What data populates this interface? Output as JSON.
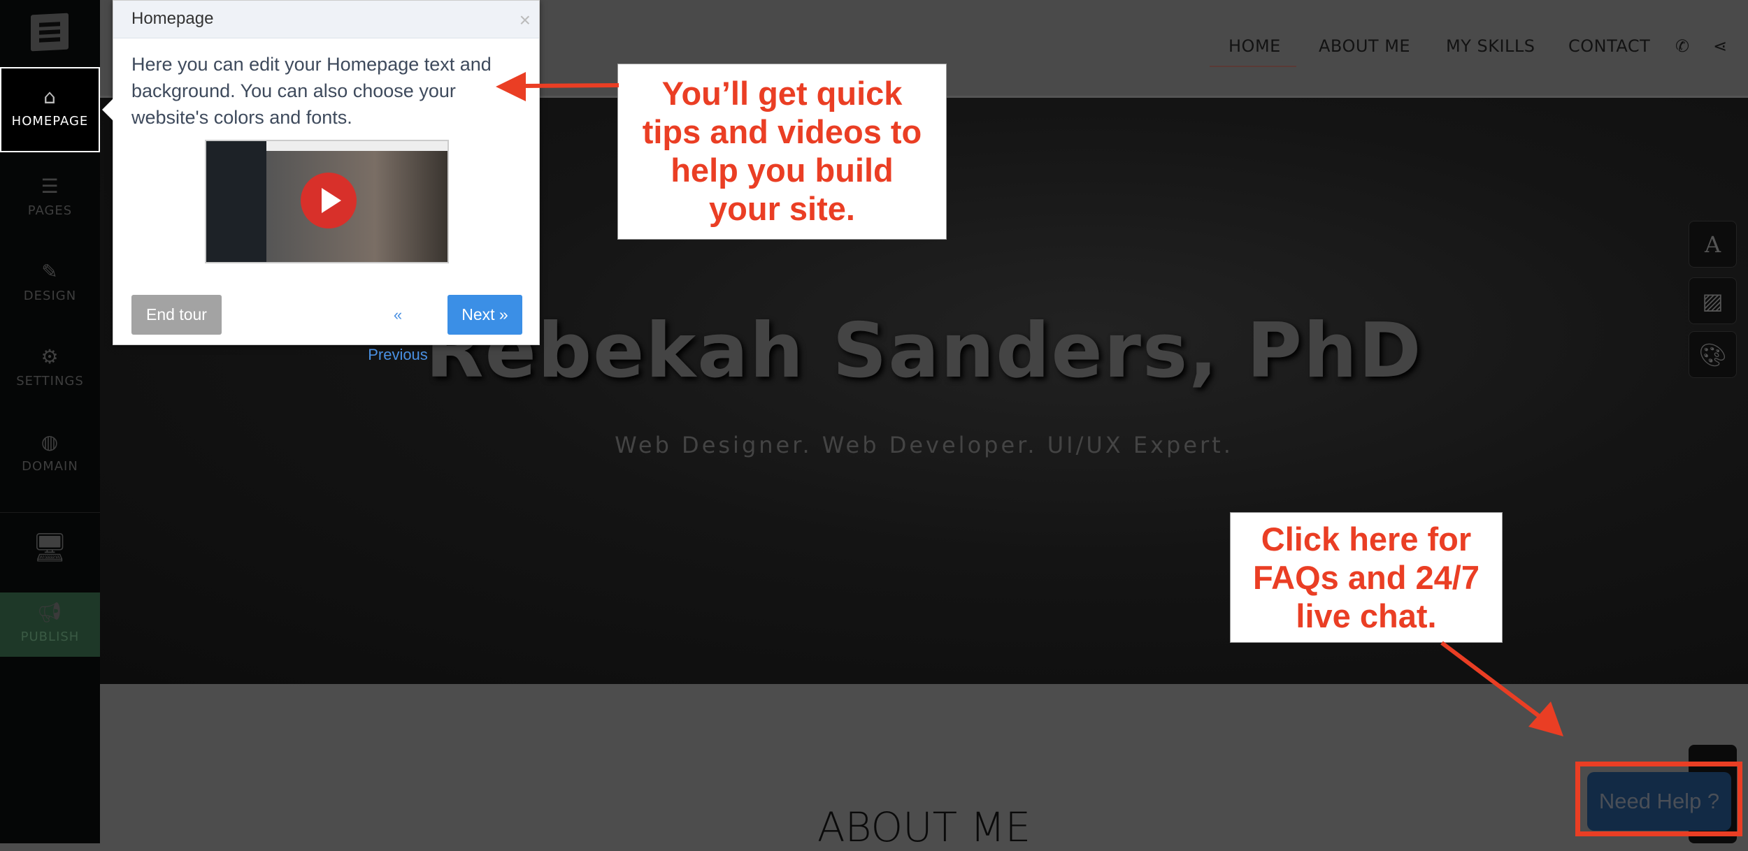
{
  "sidebar": {
    "items": [
      {
        "label": "HOMEPAGE",
        "icon": "home-icon"
      },
      {
        "label": "PAGES",
        "icon": "pages-icon"
      },
      {
        "label": "DESIGN",
        "icon": "brush-icon"
      },
      {
        "label": "SETTINGS",
        "icon": "gear-icon"
      },
      {
        "label": "DOMAIN",
        "icon": "globe-icon"
      }
    ],
    "publish": "PUBLISH"
  },
  "nav": {
    "items": [
      "HOME",
      "ABOUT ME",
      "MY SKILLS",
      "CONTACT"
    ],
    "active": "HOME"
  },
  "hero": {
    "title": "Rebekah Sanders, PhD",
    "subtitle": "Web Designer. Web Developer. UI/UX Expert."
  },
  "section": {
    "title": "ABOUT ME"
  },
  "tour": {
    "title": "Homepage",
    "body": "Here you can edit your Homepage text and background. You can also choose your website's colors and fonts.",
    "end": "End tour",
    "previous": "« Previous",
    "next": "Next »",
    "close": "×"
  },
  "annotations": {
    "tips": "You’ll get quick tips and videos to help you build your site.",
    "help": "Click here for FAQs and 24/7 live chat."
  },
  "help_button": "Need Help ?",
  "colors": {
    "annotation": "#ea3e24",
    "next_button": "#3b8fe6",
    "publish": "#1e3828"
  }
}
